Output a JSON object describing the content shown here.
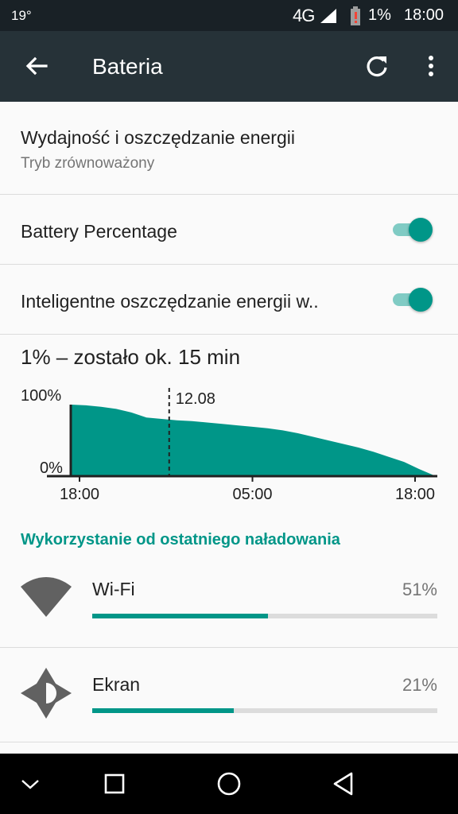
{
  "status_bar": {
    "temperature": "19°",
    "network": "4G",
    "battery_percent": "1%",
    "time": "18:00"
  },
  "toolbar": {
    "title": "Bateria",
    "back_icon": "arrow-back-icon",
    "refresh_icon": "refresh-icon",
    "menu_icon": "more-vert-icon"
  },
  "preferences": {
    "performance": {
      "title": "Wydajność i oszczędzanie energii",
      "summary": "Tryb zrównoważony"
    },
    "battery_percentage": {
      "title": "Battery Percentage",
      "enabled": true
    },
    "smart_saving": {
      "title": "Inteligentne oszczędzanie energii w..",
      "enabled": true
    }
  },
  "battery_summary": "1% – zostało ok. 15 min",
  "chart_data": {
    "type": "area",
    "y_tick_labels": [
      "100%",
      "0%"
    ],
    "x_tick_labels": [
      "18:00",
      "05:00",
      "18:00"
    ],
    "marker_label": "12.08",
    "ylim": [
      0,
      100
    ],
    "xlim": [
      0,
      24
    ],
    "marker_x": 6.5,
    "x": [
      0,
      1,
      2,
      3,
      4,
      5,
      6,
      7,
      8,
      9,
      10,
      11,
      12,
      13,
      14,
      15,
      16,
      17,
      18,
      19,
      20,
      21,
      22,
      23,
      24
    ],
    "values": [
      100,
      99,
      97,
      94,
      89,
      82,
      80,
      78,
      77,
      75,
      73,
      71,
      69,
      67,
      64,
      60,
      55,
      50,
      45,
      40,
      34,
      27,
      20,
      10,
      1
    ],
    "fill_color": "#009688",
    "grid": false
  },
  "usage_section": {
    "header": "Wykorzystanie od ostatniego naładowania",
    "items": [
      {
        "name": "Wi-Fi",
        "percent": "51%",
        "fraction": 0.51,
        "icon": "wifi-icon"
      },
      {
        "name": "Ekran",
        "percent": "21%",
        "fraction": 0.41,
        "icon": "brightness-icon"
      }
    ]
  },
  "nav_bar": {
    "icons": [
      "chevron-down-icon",
      "recents-icon",
      "home-icon",
      "back-icon"
    ]
  },
  "colors": {
    "accent": "#009688",
    "toolbar": "#263238",
    "status_bar": "#192126"
  }
}
